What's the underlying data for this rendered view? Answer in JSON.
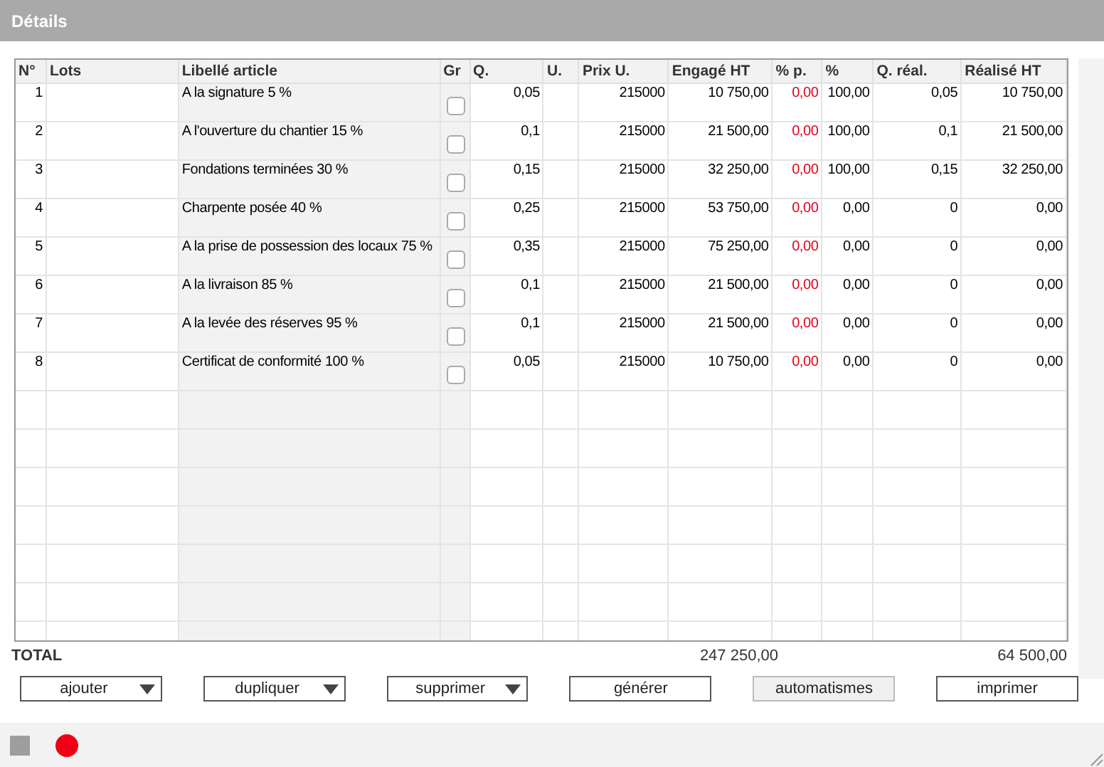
{
  "window": {
    "title": "Détails"
  },
  "table": {
    "columns": [
      "N°",
      "Lots",
      "Libellé article",
      "Gr",
      "Q.",
      "U.",
      "Prix U.",
      "Engagé HT",
      "% p.",
      "%",
      "Q. réal.",
      "Réalisé HT"
    ],
    "rows": [
      {
        "no": "1",
        "libelle": "A la signature 5 %",
        "checked": false,
        "q": "0,05",
        "prix": "215000",
        "engage": "10 750,00",
        "pct_p": "0,00",
        "pct": "100,00",
        "q_real": "0,05",
        "realise": "10 750,00"
      },
      {
        "no": "2",
        "libelle": "A l'ouverture du chantier 15 %",
        "checked": false,
        "q": "0,1",
        "prix": "215000",
        "engage": "21 500,00",
        "pct_p": "0,00",
        "pct": "100,00",
        "q_real": "0,1",
        "realise": "21 500,00"
      },
      {
        "no": "3",
        "libelle": "Fondations terminées 30 %",
        "checked": false,
        "q": "0,15",
        "prix": "215000",
        "engage": "32 250,00",
        "pct_p": "0,00",
        "pct": "100,00",
        "q_real": "0,15",
        "realise": "32 250,00"
      },
      {
        "no": "4",
        "libelle": "Charpente posée 40 %",
        "checked": false,
        "q": "0,25",
        "prix": "215000",
        "engage": "53 750,00",
        "pct_p": "0,00",
        "pct": "0,00",
        "q_real": "0",
        "realise": "0,00"
      },
      {
        "no": "5",
        "libelle": "A la prise de possession des locaux 75 %",
        "checked": false,
        "q": "0,35",
        "prix": "215000",
        "engage": "75 250,00",
        "pct_p": "0,00",
        "pct": "0,00",
        "q_real": "0",
        "realise": "0,00"
      },
      {
        "no": "6",
        "libelle": "A la livraison 85 %",
        "checked": false,
        "q": "0,1",
        "prix": "215000",
        "engage": "21 500,00",
        "pct_p": "0,00",
        "pct": "0,00",
        "q_real": "0",
        "realise": "0,00"
      },
      {
        "no": "7",
        "libelle": "A la levée des réserves 95 %",
        "checked": false,
        "q": "0,1",
        "prix": "215000",
        "engage": "21 500,00",
        "pct_p": "0,00",
        "pct": "0,00",
        "q_real": "0",
        "realise": "0,00"
      },
      {
        "no": "8",
        "libelle": "Certificat de conformité 100 %",
        "checked": false,
        "q": "0,05",
        "prix": "215000",
        "engage": "10 750,00",
        "pct_p": "0,00",
        "pct": "0,00",
        "q_real": "0",
        "realise": "0,00"
      }
    ]
  },
  "totals": {
    "label": "TOTAL",
    "engage": "247 250,00",
    "realise": "64 500,00"
  },
  "buttons": [
    {
      "label": "ajouter",
      "kind": "menu"
    },
    {
      "label": "dupliquer",
      "kind": "menu"
    },
    {
      "label": "supprimer",
      "kind": "menu"
    },
    {
      "label": "générer",
      "kind": "plain"
    },
    {
      "label": "automatismes",
      "kind": "flat"
    },
    {
      "label": "imprimer",
      "kind": "plain"
    }
  ]
}
